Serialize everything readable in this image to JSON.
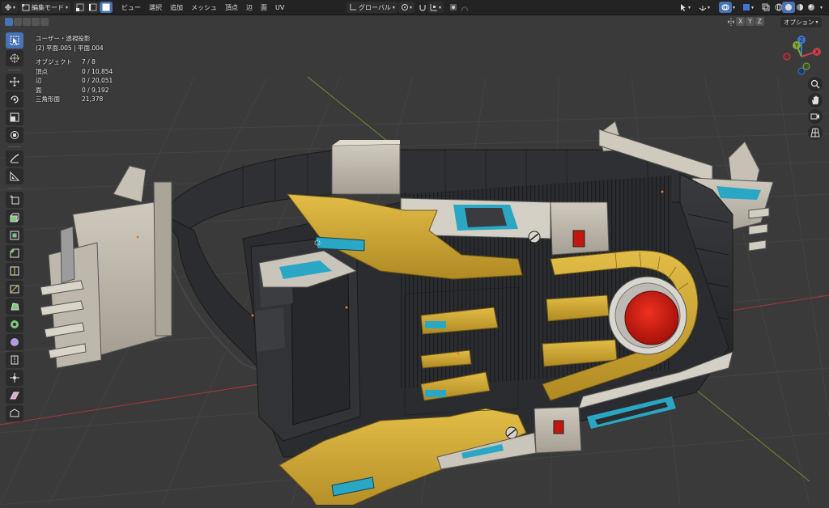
{
  "header": {
    "mode_label": "編集モード",
    "menus": [
      "ビュー",
      "選択",
      "追加",
      "メッシュ",
      "頂点",
      "辺",
      "面",
      "UV"
    ],
    "transform_orientation": "グローバル",
    "options_label": "オプション",
    "axis_x": "X",
    "axis_y": "Y",
    "axis_z": "Z"
  },
  "overlay": {
    "view_name": "ユーザー・透視投影",
    "object_name": "(2) 平面.005 | 平面.004",
    "stats": [
      {
        "label": "オブジェクト",
        "value": "7 / 8"
      },
      {
        "label": "頂点",
        "value": "0 / 10,854"
      },
      {
        "label": "辺",
        "value": "0 / 20,051"
      },
      {
        "label": "面",
        "value": "0 / 9,192"
      },
      {
        "label": "三角形面",
        "value": "21,378"
      }
    ]
  },
  "gizmo": {
    "x": "X",
    "y": "Y",
    "z": "Z"
  },
  "tools": [
    "select-box-icon",
    "cursor-icon",
    "move-icon",
    "rotate-icon",
    "scale-icon",
    "transform-icon",
    "annotate-icon",
    "measure-icon",
    "add-cube-icon",
    "extrude-icon",
    "inset-icon",
    "bevel-icon",
    "loop-cut-icon",
    "knife-icon",
    "poly-build-icon",
    "spin-icon",
    "smooth-icon",
    "edge-slide-icon",
    "shrink-fatten-icon",
    "shear-icon",
    "rip-icon"
  ],
  "colors": {
    "accent": "#4772b3",
    "header_bg": "#232323",
    "viewport_bg": "#3a3a3a",
    "axis_x_red": "#c8414a",
    "axis_y_green": "#7fa83a",
    "axis_z_blue": "#3d78d0",
    "gold": "#c9a432",
    "teal": "#2aa7c4",
    "panel_gray": "#b8b3a6",
    "dark_body": "#2c2d2f",
    "red_gem": "#d01c12"
  }
}
